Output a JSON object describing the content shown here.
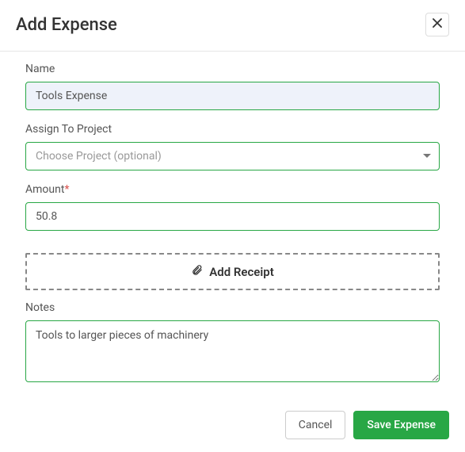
{
  "header": {
    "title": "Add Expense"
  },
  "fields": {
    "name": {
      "label": "Name",
      "value": "Tools Expense"
    },
    "project": {
      "label": "Assign To Project",
      "placeholder": "Choose Project (optional)"
    },
    "amount": {
      "label": "Amount",
      "required_mark": "*",
      "value": "50.8"
    },
    "receipt": {
      "label": "Add Receipt"
    },
    "notes": {
      "label": "Notes",
      "value": "Tools to larger pieces of machinery"
    }
  },
  "footer": {
    "cancel": "Cancel",
    "save": "Save Expense"
  }
}
